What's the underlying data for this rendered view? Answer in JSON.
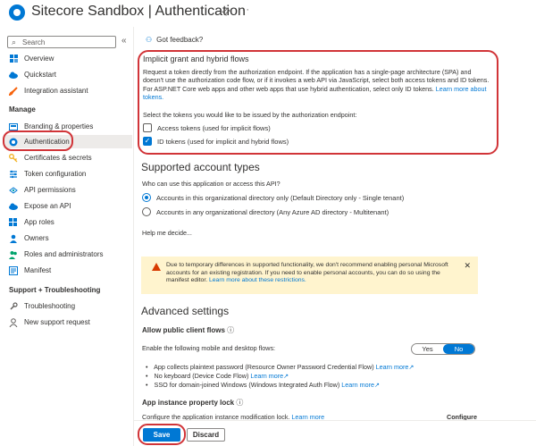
{
  "header": {
    "title": "Sitecore Sandbox | Authentication",
    "pin_icon": "pin-icon",
    "more_label": "···"
  },
  "sidebar": {
    "search_placeholder": "Search",
    "collapse_label": "«",
    "items_top": [
      {
        "label": "Overview",
        "icon": "grid-icon"
      },
      {
        "label": "Quickstart",
        "icon": "cloud-icon"
      },
      {
        "label": "Integration assistant",
        "icon": "rocket-icon"
      }
    ],
    "manage_heading": "Manage",
    "items_manage": [
      {
        "label": "Branding & properties",
        "icon": "branding-icon"
      },
      {
        "label": "Authentication",
        "icon": "authentication-icon",
        "active": true
      },
      {
        "label": "Certificates & secrets",
        "icon": "key-icon"
      },
      {
        "label": "Token configuration",
        "icon": "token-icon"
      },
      {
        "label": "API permissions",
        "icon": "permissions-icon"
      },
      {
        "label": "Expose an API",
        "icon": "cloud-api-icon"
      },
      {
        "label": "App roles",
        "icon": "app-roles-icon"
      },
      {
        "label": "Owners",
        "icon": "owners-icon"
      },
      {
        "label": "Roles and administrators",
        "icon": "roles-icon"
      },
      {
        "label": "Manifest",
        "icon": "manifest-icon"
      }
    ],
    "support_heading": "Support + Troubleshooting",
    "items_support": [
      {
        "label": "Troubleshooting",
        "icon": "wrench-icon"
      },
      {
        "label": "New support request",
        "icon": "support-request-icon"
      }
    ]
  },
  "main": {
    "feedback_label": "Got feedback?",
    "implicit": {
      "heading": "Implicit grant and hybrid flows",
      "description": "Request a token directly from the authorization endpoint. If the application has a single-page architecture (SPA) and doesn't use the authorization code flow, or if it invokes a web API via JavaScript, select both access tokens and ID tokens. For ASP.NET Core web apps and other web apps that use hybrid authentication, select only ID tokens.",
      "learn_more": "Learn more about tokens.",
      "select_prompt": "Select the tokens you would like to be issued by the authorization endpoint:",
      "access_tokens_label": "Access tokens (used for implicit flows)",
      "access_tokens_checked": false,
      "id_tokens_label": "ID tokens (used for implicit and hybrid flows)",
      "id_tokens_checked": true
    },
    "accounts": {
      "heading": "Supported account types",
      "question": "Who can use this application or access this API?",
      "option_single": "Accounts in this organizational directory only (Default Directory only - Single tenant)",
      "option_multi": "Accounts in any organizational directory (Any Azure AD directory - Multitenant)",
      "selected": "single",
      "help_link": "Help me decide..."
    },
    "warning": {
      "text": "Due to temporary differences in supported functionality, we don't recommend enabling personal Microsoft accounts for an existing registration. If you need to enable personal accounts, you can do so using the manifest editor.",
      "link": "Learn more about these restrictions.",
      "close_label": "✕"
    },
    "advanced": {
      "heading": "Advanced settings",
      "public_client_heading": "Allow public client flows",
      "enable_label": "Enable the following mobile and desktop flows:",
      "toggle_yes": "Yes",
      "toggle_no": "No",
      "toggle_selected": "No",
      "flows": [
        {
          "text": "App collects plaintext password (Resource Owner Password Credential Flow)",
          "link": "Learn more"
        },
        {
          "text": "No keyboard (Device Code Flow)",
          "link": "Learn more"
        },
        {
          "text": "SSO for domain-joined Windows (Windows Integrated Auth Flow)",
          "link": "Learn more"
        }
      ],
      "lock_heading": "App instance property lock",
      "lock_text": "Configure the application instance modification lock.",
      "lock_link": "Learn more",
      "configure_link": "Configure"
    }
  },
  "footer": {
    "save_label": "Save",
    "discard_label": "Discard"
  },
  "colors": {
    "accent": "#0078d4",
    "highlight_ring": "#d13438",
    "warning_bg": "#fff4ce"
  }
}
